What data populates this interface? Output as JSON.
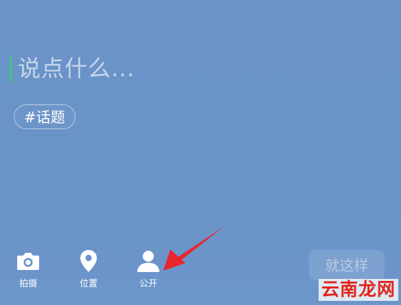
{
  "compose": {
    "placeholder": "说点什么..."
  },
  "topic": {
    "label": "#话题"
  },
  "toolbar": {
    "items": [
      {
        "label": "拍摄",
        "icon": "camera-icon"
      },
      {
        "label": "位置",
        "icon": "location-pin-icon"
      },
      {
        "label": "公开",
        "icon": "person-icon"
      }
    ],
    "confirm_label": "就这样"
  },
  "annotation": {
    "arrow_color": "#e8262b"
  },
  "watermark": {
    "text": "云南龙网"
  },
  "colors": {
    "background": "#6b93c9",
    "caret": "#3cc97a"
  }
}
